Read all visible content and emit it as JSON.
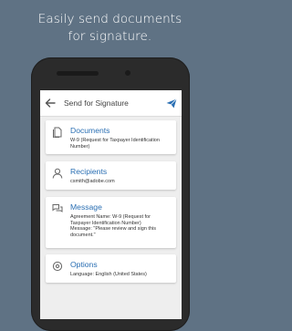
{
  "headline": {
    "line1": "Easily send documents",
    "line2": "for signature."
  },
  "appbar": {
    "title": "Send for Signature",
    "back_icon": "arrow-left-icon",
    "send_icon": "paper-plane-icon",
    "accent": "#2a6fb3"
  },
  "cards": {
    "documents": {
      "title": "Documents",
      "detail_line1": "W-9 (Request for Taxpayer Identification",
      "detail_line2": "Number)",
      "icon": "document-icon"
    },
    "recipients": {
      "title": "Recipients",
      "detail": "csmith@adobe.com",
      "icon": "person-icon"
    },
    "message": {
      "title": "Message",
      "line1": "Agreement Name: W-9 (Request for",
      "line2": "Taxpayer Identification Number)",
      "line3": "Message: \"Please review and sign this",
      "line4": "document.\"",
      "icon": "chat-bubbles-icon"
    },
    "options": {
      "title": "Options",
      "detail": "Language: English (United States)",
      "icon": "settings-icon"
    }
  },
  "colors": {
    "background": "#5f7284",
    "icon_gray": "#666666"
  }
}
